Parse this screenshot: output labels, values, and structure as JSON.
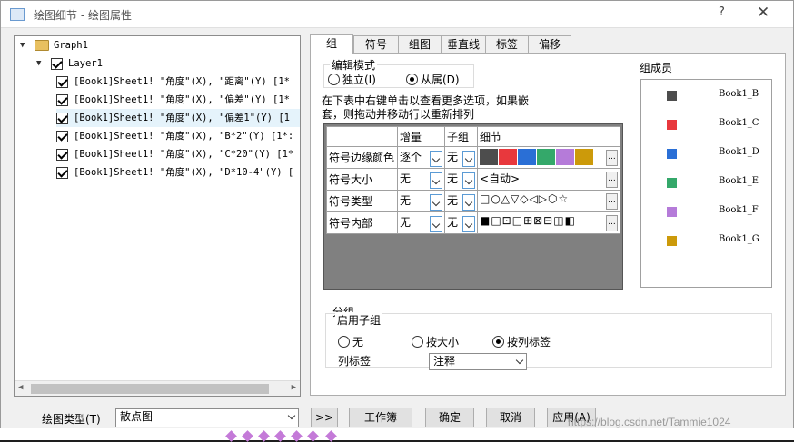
{
  "window": {
    "title": "绘图细节 - 绘图属性",
    "help": "?",
    "close": "✕"
  },
  "tree": {
    "root": "Graph1",
    "layer": "Layer1",
    "items": [
      "[Book1]Sheet1! \"角度\"(X), \"距离\"(Y) [1*",
      "[Book1]Sheet1! \"角度\"(X), \"偏差\"(Y) [1*",
      "[Book1]Sheet1! \"角度\"(X), \"偏差1\"(Y) [1",
      "[Book1]Sheet1! \"角度\"(X), \"B*2\"(Y) [1*:",
      "[Book1]Sheet1! \"角度\"(X), \"C*20\"(Y) [1*",
      "[Book1]Sheet1! \"角度\"(X), \"D*10-4\"(Y) ["
    ]
  },
  "tabs": [
    "组",
    "符号",
    "组图",
    "垂直线",
    "标签",
    "偏移"
  ],
  "edit_mode": {
    "legend": "编辑模式",
    "independent": "独立(I)",
    "dependent": "从属(D)"
  },
  "hint": "在下表中右键单击以查看更多选项，如果嵌套，则拖动并移动行以重新排列",
  "grid": {
    "headers": [
      "增量",
      "子组",
      "细节"
    ],
    "rows": [
      {
        "name": "符号边缘颜色",
        "inc": "逐个",
        "sub": "无",
        "detail": ""
      },
      {
        "name": "符号大小",
        "inc": "无",
        "sub": "无",
        "detail": "<自动>"
      },
      {
        "name": "符号类型",
        "inc": "无",
        "sub": "无",
        "detail": "□○△▽◇◁▷⬡☆"
      },
      {
        "name": "符号内部",
        "inc": "无",
        "sub": "无",
        "detail": "■□⊡□⊞⊠⊟◫◧"
      }
    ],
    "colors": [
      "#4d4d4d",
      "#e8383d",
      "#2a6fd6",
      "#34a86a",
      "#b57bd9",
      "#cc9a0a"
    ],
    "ellipsis": "..."
  },
  "members": {
    "label": "组成员",
    "items": [
      {
        "name": "Book1_B",
        "color": "#4d4d4d"
      },
      {
        "name": "Book1_C",
        "color": "#e8383d"
      },
      {
        "name": "Book1_D",
        "color": "#2a6fd6"
      },
      {
        "name": "Book1_E",
        "color": "#34a86a"
      },
      {
        "name": "Book1_F",
        "color": "#b57bd9"
      },
      {
        "name": "Book1_G",
        "color": "#cc9a0a"
      }
    ]
  },
  "grouping": {
    "legend": "分组",
    "sub_legend": "启用子组",
    "opt_none": "无",
    "opt_size": "按大小",
    "opt_label": "按列标签",
    "col_label": "列标签",
    "col_value": "注释"
  },
  "footer": {
    "plot_type_label": "绘图类型(T)",
    "plot_type_value": "散点图",
    "expand": ">>",
    "workbook": "工作簿",
    "ok": "确定",
    "cancel": "取消",
    "apply": "应用(A)"
  },
  "watermark": "https://blog.csdn.net/Tammie1024"
}
